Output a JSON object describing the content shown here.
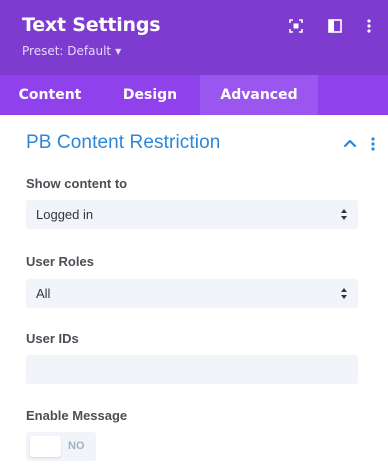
{
  "colors": {
    "header_bg": "#7e3bd0",
    "tabs_bg": "#8f42ec",
    "active_tab_bg": "#9b56f0",
    "section_title": "#2b87da",
    "field_bg": "#f1f5f9"
  },
  "header": {
    "title": "Text Settings",
    "preset": "Preset: Default",
    "icons": [
      "fullscreen-icon",
      "columns-icon",
      "more-vertical-icon"
    ]
  },
  "tabs": [
    {
      "label": "Content",
      "active": false
    },
    {
      "label": "Design",
      "active": false
    },
    {
      "label": "Advanced",
      "active": true
    }
  ],
  "section": {
    "title": "PB Content Restriction",
    "expanded": true
  },
  "fields": {
    "show_content": {
      "label": "Show content to",
      "value": "Logged in"
    },
    "user_roles": {
      "label": "User Roles",
      "value": "All"
    },
    "user_ids": {
      "label": "User IDs",
      "value": ""
    },
    "enable_message": {
      "label": "Enable Message",
      "state": "NO"
    }
  }
}
